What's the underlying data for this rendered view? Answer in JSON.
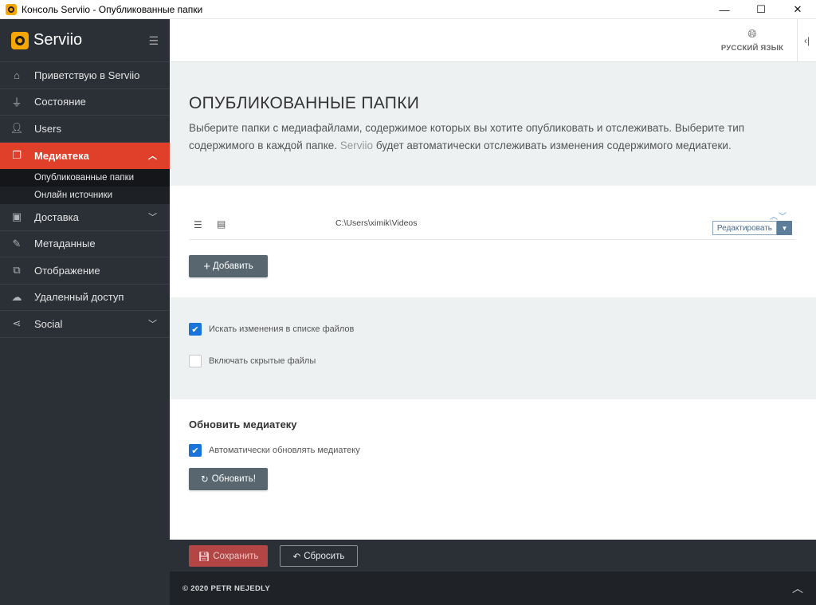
{
  "window": {
    "title": "Консоль Serviio - Опубликованные папки",
    "minimize": "—",
    "maximize": "☐",
    "close": "✕"
  },
  "brand": {
    "name": "Serviio"
  },
  "sidebar": {
    "items": [
      {
        "label": "Приветствую в Serviio",
        "icon": "home-icon"
      },
      {
        "label": "Состояние",
        "icon": "plug-icon"
      },
      {
        "label": "Users",
        "icon": "user-icon"
      },
      {
        "label": "Медиатека",
        "icon": "library-icon",
        "active": true
      },
      {
        "label": "Доставка",
        "icon": "box-icon"
      },
      {
        "label": "Метаданные",
        "icon": "edit-icon"
      },
      {
        "label": "Отображение",
        "icon": "display-icon"
      },
      {
        "label": "Удаленный доступ",
        "icon": "cloud-icon"
      },
      {
        "label": "Social",
        "icon": "share-icon"
      }
    ],
    "subitems": [
      {
        "label": "Опубликованные папки",
        "current": true
      },
      {
        "label": "Онлайн источники"
      }
    ]
  },
  "topbar": {
    "language": "РУССКИЙ ЯЗЫК"
  },
  "hero": {
    "title": "ОПУБЛИКОВАННЫЕ ПАПКИ",
    "desc_part1": "Выберите папки с медиафайлами, содержимое которых вы хотите опубликовать и отслеживать. Выберите тип содержимого в каждой папке. ",
    "desc_brand": "Serviio",
    "desc_part2": " будет автоматически отслеживать изменения содержимого медиатеки."
  },
  "folders": {
    "rows": [
      {
        "path": "C:\\Users\\ximik\\Videos",
        "edit_label": "Редактировать"
      }
    ],
    "add_label": "Добавить"
  },
  "options": {
    "watch_changes": {
      "label": "Искать изменения в списке файлов",
      "checked": true
    },
    "include_hidden": {
      "label": "Включать скрытые файлы",
      "checked": false
    }
  },
  "refresh": {
    "title": "Обновить медиатеку",
    "auto_label": "Автоматически обновлять медиатеку",
    "auto_checked": true,
    "button_label": "Обновить!"
  },
  "actions": {
    "save_label": "Сохранить",
    "reset_label": "Сбросить"
  },
  "footer": {
    "copyright": "© 2020 PETR NEJEDLY"
  },
  "colors": {
    "accent": "#e0402a",
    "sidebar": "#2b2f36",
    "checkbox": "#1a73d9",
    "button": "#57666f",
    "save": "#b34545"
  }
}
